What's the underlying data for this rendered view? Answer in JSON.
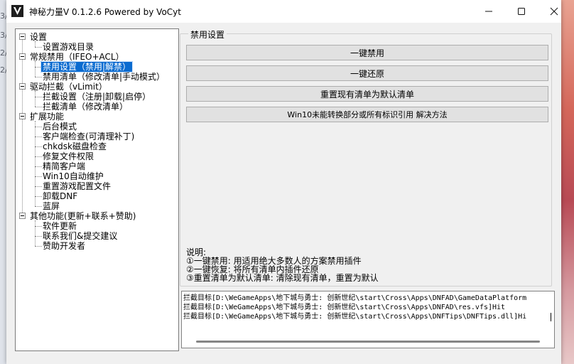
{
  "window": {
    "title": "神秘力量V 0.1.2.6  Powered by VoCyt",
    "controls": {
      "minimize": "—",
      "maximize": "☐",
      "close": "✕"
    }
  },
  "tree": {
    "nodes": [
      {
        "label": "设置"
      },
      {
        "label": "设置游戏目录"
      },
      {
        "label": "常规禁用（IFEO+ACL）"
      },
      {
        "label": "禁用设置（禁用|解禁）"
      },
      {
        "label": "禁用清单（修改清单|手动模式）"
      },
      {
        "label": "驱动拦截（vLimit）"
      },
      {
        "label": "拦截设置（注册|卸载|启停）"
      },
      {
        "label": "拦截清单（修改清单）"
      },
      {
        "label": "扩展功能"
      },
      {
        "label": "后台模式"
      },
      {
        "label": "客户端检查(可清理补丁)"
      },
      {
        "label": "chkdsk磁盘检查"
      },
      {
        "label": "修复文件权限"
      },
      {
        "label": "精简客户端"
      },
      {
        "label": "Win10自动维护"
      },
      {
        "label": "重置游戏配置文件"
      },
      {
        "label": "卸载DNF"
      },
      {
        "label": "蓝屏"
      },
      {
        "label": "其他功能(更新+联系+赞助)"
      },
      {
        "label": "软件更新"
      },
      {
        "label": "联系我们&提交建议"
      },
      {
        "label": "赞助开发者"
      }
    ]
  },
  "panel": {
    "group_label": "禁用设置",
    "buttons": [
      "一键禁用",
      "一键还原",
      "重置现有清单为默认清单",
      "Win10未能转换部分或所有标识引用 解决方法"
    ],
    "notes": [
      "说明:",
      "①一键禁用: 用适用绝大多数人的方案禁用插件",
      "②一键恢复: 将所有清单内插件还原",
      "③重置清单为默认清单: 清除现有清单，重置为默认"
    ]
  },
  "log": {
    "lines": [
      "拦截目标[D:\\WeGameApps\\地下城与勇士: 创新世纪\\start\\Cross\\Apps\\DNFAD\\GameDataPlatform",
      "拦截目标[D:\\WeGameApps\\地下城与勇士: 创新世纪\\start\\Cross\\Apps\\DNFAD\\res.vfs]Hit",
      "拦截目标[D:\\WeGameApps\\地下城与勇士: 创新世纪\\start\\Cross\\Apps\\DNFTips\\DNFTips.dll]Hi"
    ]
  },
  "desktop_left": [
    "3/",
    "3/",
    "2/",
    "2/"
  ],
  "colors": {
    "selection": "#0a6bd0",
    "button": "#e1e1e1",
    "window_bg": "#f0f0f0"
  }
}
